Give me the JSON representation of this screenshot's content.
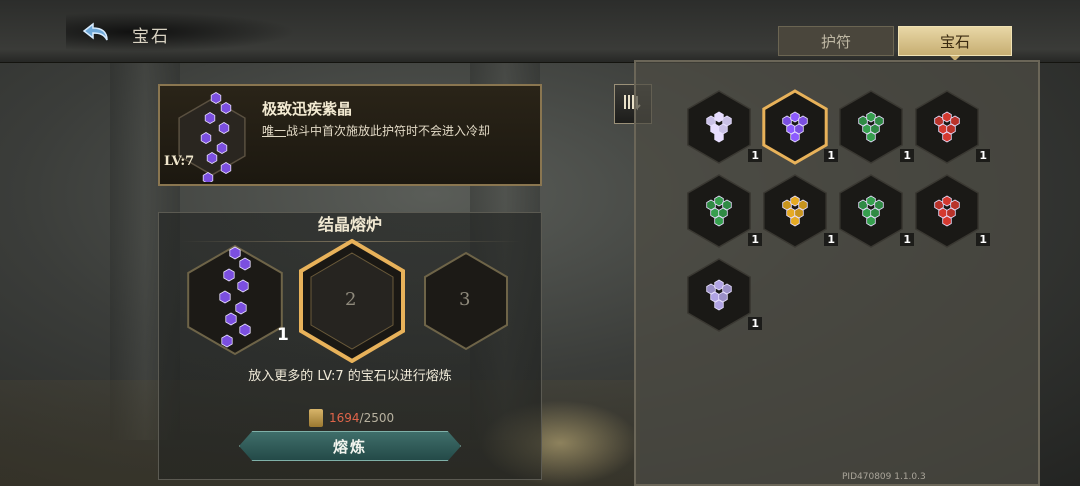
{
  "header": {
    "title": "宝石",
    "back_icon": "back-arrow-icon"
  },
  "tabs": [
    {
      "label": "护符",
      "active": false
    },
    {
      "label": "宝石",
      "active": true
    }
  ],
  "selected_gem": {
    "name": "极致迅疾紫晶",
    "tag": "唯一",
    "description": "战斗中首次施放此护符时不会进入冷却",
    "level": "LV:7",
    "color": "#7b4fe0"
  },
  "furnace": {
    "title": "结晶熔炉",
    "slots": [
      {
        "label": "",
        "count": "1",
        "filled": true
      },
      {
        "label": "2",
        "filled": false,
        "highlighted": true
      },
      {
        "label": "3",
        "filled": false
      }
    ],
    "hint": "放入更多的 LV:7 的宝石以进行熔炼",
    "cost_current": "1694",
    "cost_max": "/2500",
    "smelt_label": "熔炼"
  },
  "inventory": [
    {
      "color": "#c9c0e6",
      "count": "1",
      "selected": false
    },
    {
      "color": "#7b4fe0",
      "count": "1",
      "selected": true
    },
    {
      "color": "#2f8a44",
      "count": "1",
      "selected": false
    },
    {
      "color": "#b8322a",
      "count": "1",
      "selected": false
    },
    {
      "color": "#2f8a44",
      "count": "1",
      "selected": false
    },
    {
      "color": "#c8941e",
      "count": "1",
      "selected": false
    },
    {
      "color": "#2f8a44",
      "count": "1",
      "selected": false
    },
    {
      "color": "#b8322a",
      "count": "1",
      "selected": false
    },
    {
      "color": "#9a8fc6",
      "count": "1",
      "selected": false
    }
  ],
  "footer": {
    "pid": "PID470809  1.1.0.3"
  }
}
